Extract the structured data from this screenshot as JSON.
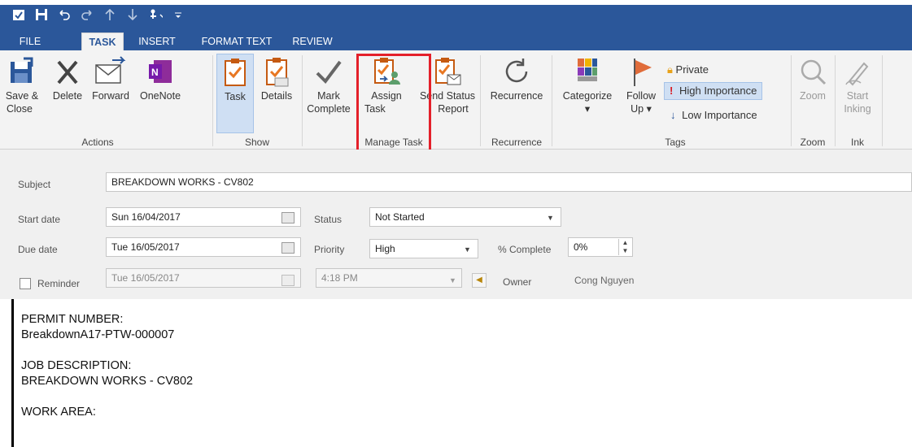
{
  "qat": {
    "save_icon": "save-icon",
    "undo_icon": "undo-icon",
    "redo_icon": "redo-icon",
    "up_icon": "previous-item-icon",
    "down_icon": "next-item-icon",
    "touch_icon": "touch-mode-icon",
    "customize_icon": "customize-qat-icon"
  },
  "tabs": [
    "FILE",
    "TASK",
    "INSERT",
    "FORMAT TEXT",
    "REVIEW"
  ],
  "ribbon": {
    "actions": {
      "group_label": "Actions",
      "save_close": [
        "Save &",
        "Close"
      ],
      "delete": "Delete",
      "forward": "Forward",
      "onenote": "OneNote"
    },
    "show": {
      "group_label": "Show",
      "task": "Task",
      "details": "Details"
    },
    "manage_task": {
      "group_label": "Manage Task",
      "mark_complete": [
        "Mark",
        "Complete"
      ],
      "assign_task": [
        "Assign",
        "Task"
      ],
      "send_status_report": [
        "Send Status",
        "Report"
      ]
    },
    "recurrence": {
      "group_label": "Recurrence",
      "recurrence": "Recurrence"
    },
    "tags": {
      "group_label": "Tags",
      "categorize": "Categorize",
      "follow_up": [
        "Follow",
        "Up"
      ],
      "private": "Private",
      "high_importance": "High Importance",
      "low_importance": "Low Importance"
    },
    "zoom": {
      "group_label": "Zoom",
      "zoom": "Zoom"
    },
    "ink": {
      "group_label": "Ink",
      "start_inking": [
        "Start",
        "Inking"
      ]
    }
  },
  "form": {
    "subject_label": "Subject",
    "subject_value": "BREAKDOWN WORKS - CV802",
    "start_date_label": "Start date",
    "start_date_value": "Sun 16/04/2017",
    "due_date_label": "Due date",
    "due_date_value": "Tue 16/05/2017",
    "reminder_label": "Reminder",
    "reminder_date": "Tue 16/05/2017",
    "reminder_time": "4:18 PM",
    "status_label": "Status",
    "status_value": "Not Started",
    "priority_label": "Priority",
    "priority_value": "High",
    "complete_label": "% Complete",
    "complete_value": "0%",
    "owner_label": "Owner",
    "owner_value": "Cong Nguyen"
  },
  "body": {
    "permit_label": "PERMIT NUMBER:",
    "permit_value": "BreakdownA17-PTW-000007",
    "job_label": "JOB DESCRIPTION:",
    "job_value": "BREAKDOWN WORKS - CV802",
    "area_label": "WORK AREA:"
  },
  "colors": {
    "title_bar": "#2b579a",
    "ribbon_bg": "#f3f3f3",
    "selected_bg": "#cfdff3",
    "highlight_box": "#e4202a"
  }
}
